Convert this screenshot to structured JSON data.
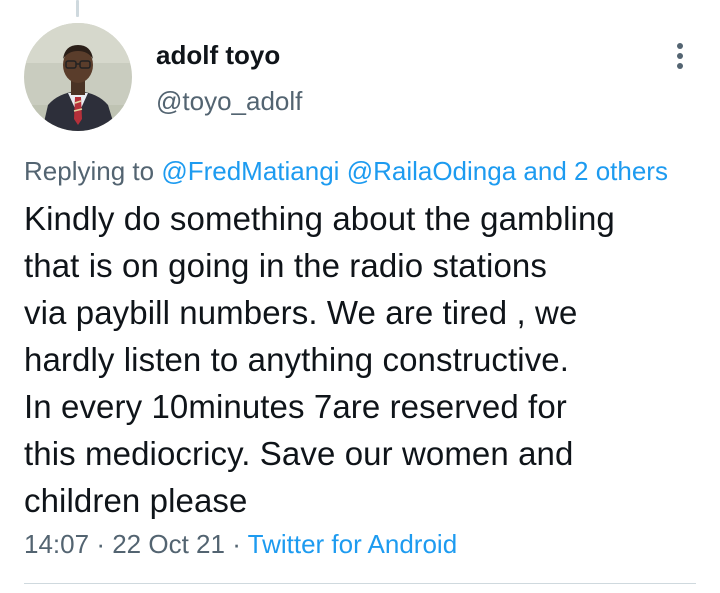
{
  "author": {
    "display_name": "adolf toyo",
    "handle": "@toyo_adolf",
    "avatar_icon": "profile-photo"
  },
  "more_icon": "more-vertical-icon",
  "reply_context": {
    "prefix": "Replying to",
    "mentions": [
      "@FredMatiangi",
      "@RailaOdinga"
    ],
    "others": "and 2 others"
  },
  "tweet_text_lines": [
    "Kindly do something about the gambling",
    "that is on going in the radio stations",
    "via paybill numbers. We are tired , we",
    "hardly listen to anything constructive.",
    "In every 10minutes 7are reserved for",
    "this mediocricy. Save our women and",
    "children please"
  ],
  "meta": {
    "time": "14:07",
    "date": "22 Oct 21",
    "separator": "·",
    "source": "Twitter for Android"
  },
  "colors": {
    "text_primary": "#0f1419",
    "text_secondary": "#536471",
    "link": "#1d9bf0",
    "divider": "#cfd9de"
  }
}
